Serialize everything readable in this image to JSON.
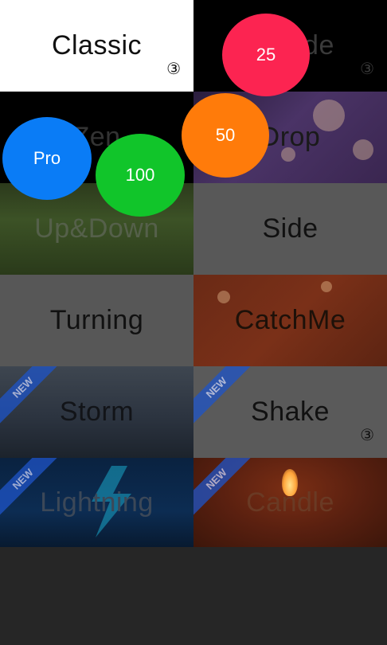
{
  "modes": [
    {
      "label": "Classic",
      "count": "③"
    },
    {
      "label": "Arcade",
      "count": "③"
    },
    {
      "label": "Zen",
      "count": ""
    },
    {
      "label": "Drop",
      "count": ""
    },
    {
      "label": "Up&Down",
      "count": ""
    },
    {
      "label": "Side",
      "count": ""
    },
    {
      "label": "Turning",
      "count": ""
    },
    {
      "label": "CatchMe",
      "count": ""
    },
    {
      "label": "Storm",
      "count": ""
    },
    {
      "label": "Shake",
      "count": "③"
    },
    {
      "label": "Lightning",
      "count": ""
    },
    {
      "label": "Candle",
      "count": ""
    }
  ],
  "new_badge": "NEW",
  "bubbles": {
    "b25": "25",
    "b50": "50",
    "b100": "100",
    "pro": "Pro"
  },
  "colors": {
    "b25": "#fc2451",
    "b50": "#ff7b0a",
    "b100": "#11c52a",
    "pro": "#0a7cf6"
  }
}
